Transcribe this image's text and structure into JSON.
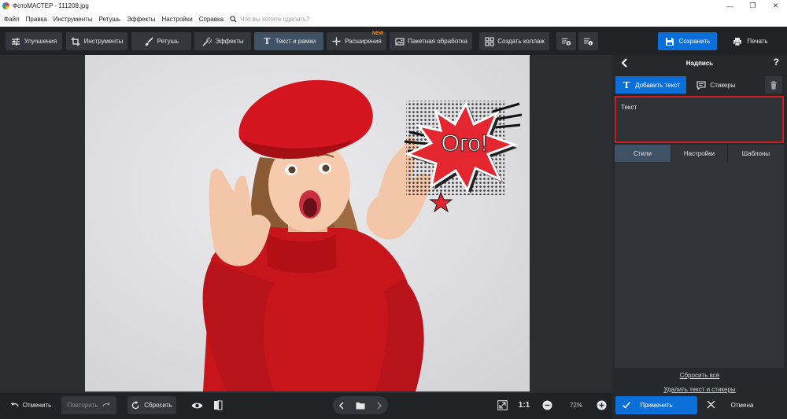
{
  "window": {
    "title": "ФотоМАСТЕР - 111208.jpg",
    "controls": [
      "—",
      "❐",
      "✕"
    ]
  },
  "menu": {
    "items": [
      "Файл",
      "Правка",
      "Инструменты",
      "Ретушь",
      "Эффекты",
      "Настройки",
      "Справка"
    ],
    "search_placeholder": "Что вы хотите сделать?"
  },
  "toolbar": {
    "tabs": [
      {
        "label": "Улучшения",
        "icon": "sliders-icon"
      },
      {
        "label": "Инструменты",
        "icon": "crop-icon"
      },
      {
        "label": "Ретушь",
        "icon": "brush-icon"
      },
      {
        "label": "Эффекты",
        "icon": "magic-wand-icon"
      },
      {
        "label": "Текст и рамки",
        "icon": "text-icon",
        "active": true
      },
      {
        "label": "Расширения",
        "icon": "plus-icon",
        "badge": "NEW"
      },
      {
        "label": "Пакетная обработка",
        "icon": "images-icon"
      },
      {
        "label": "Создать коллаж",
        "icon": "collage-icon"
      }
    ],
    "save_label": "Сохранить",
    "print_label": "Печать",
    "accent": "#0a6fd9",
    "badge_color": "#ff8a1c"
  },
  "canvas": {
    "sticker_text": "Ого!",
    "sticker_color": "#e32630"
  },
  "bottom": {
    "undo_label": "Отменить",
    "redo_label": "Повторить",
    "reset_label": "Сбросить",
    "ratio_label": "1:1",
    "zoom_value": "72%"
  },
  "panel": {
    "title": "Надпись",
    "help": "?",
    "tab_add_text": "Добавить текст",
    "tab_stickers": "Стикеры",
    "text_value": "Текст",
    "subtabs": [
      "Стили",
      "Настройки",
      "Шаблоны"
    ],
    "reset_all_link": "Сбросить всё",
    "delete_link": "Удалить текст и стикеры",
    "apply_label": "Применить",
    "cancel_label": "Отмена",
    "highlight_color": "#d11b1b"
  }
}
